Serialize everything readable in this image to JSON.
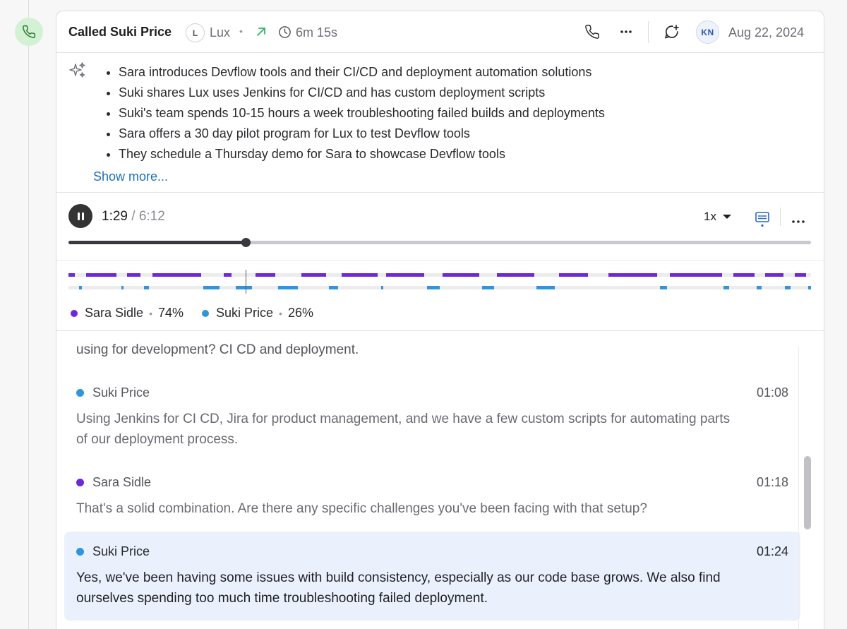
{
  "call": {
    "title": "Called Suki Price",
    "company_initial": "L",
    "company_name": "Lux",
    "separator": "•",
    "duration": "6m 15s",
    "user_initials": "KN",
    "date": "Aug 22, 2024"
  },
  "icons": {
    "call_type": "phone-icon",
    "direction": "outbound-arrow-icon",
    "duration": "clock-icon",
    "header_phone": "phone-icon",
    "header_more": "more-horizontal-icon",
    "comment": "add-comment-icon",
    "summary": "sparkle-icon",
    "captions": "captions-icon",
    "player_more": "more-horizontal-icon"
  },
  "summary": {
    "bullets": [
      "Sara introduces Devflow tools and their CI/CD and deployment automation solutions",
      "Suki shares Lux uses Jenkins for CI/CD and has custom deployment scripts",
      "Suki's team spends 10-15 hours a week troubleshooting failed builds and deployments",
      "Sara offers a 30 day pilot program for Lux to test Devflow tools",
      "They schedule a Thursday demo for Sara to showcase Devflow tools"
    ],
    "show_more_label": "Show more..."
  },
  "player": {
    "current_time": "1:29",
    "time_separator": " / ",
    "total_time": "6:12",
    "progress_fraction": 0.239,
    "speed_label": "1x"
  },
  "speakers": [
    {
      "name": "Sara Sidle",
      "percent": "74%",
      "color": "#6d28d9",
      "segments": [
        [
          0.0,
          0.009
        ],
        [
          0.024,
          0.065
        ],
        [
          0.079,
          0.097
        ],
        [
          0.113,
          0.179
        ],
        [
          0.209,
          0.22
        ],
        [
          0.252,
          0.279
        ],
        [
          0.314,
          0.347
        ],
        [
          0.368,
          0.416
        ],
        [
          0.428,
          0.479
        ],
        [
          0.504,
          0.553
        ],
        [
          0.577,
          0.627
        ],
        [
          0.661,
          0.7
        ],
        [
          0.727,
          0.793
        ],
        [
          0.81,
          0.88
        ],
        [
          0.895,
          0.924
        ],
        [
          0.938,
          0.963
        ],
        [
          0.978,
          0.993
        ]
      ]
    },
    {
      "name": "Suki Price",
      "percent": "26%",
      "color": "#2f95dc",
      "segments": [
        [
          0.014,
          0.018
        ],
        [
          0.071,
          0.074
        ],
        [
          0.102,
          0.108
        ],
        [
          0.182,
          0.203
        ],
        [
          0.225,
          0.247
        ],
        [
          0.282,
          0.309
        ],
        [
          0.351,
          0.363
        ],
        [
          0.421,
          0.424
        ],
        [
          0.483,
          0.5
        ],
        [
          0.557,
          0.573
        ],
        [
          0.63,
          0.635
        ],
        [
          0.634,
          0.639
        ],
        [
          0.63,
          0.655
        ],
        [
          0.797,
          0.806
        ],
        [
          0.882,
          0.89
        ],
        [
          0.927,
          0.933
        ],
        [
          0.965,
          0.972
        ],
        [
          0.996,
          1.0
        ]
      ]
    }
  ],
  "transcript": {
    "partial_text": "using for development? CI CD and deployment.",
    "entries": [
      {
        "speaker": "Suki Price",
        "time": "01:08",
        "text": "Using Jenkins for CI CD, Jira for product management, and we have a few custom scripts for automating parts of our deployment process.",
        "color": "#2f95dc"
      },
      {
        "speaker": "Sara Sidle",
        "time": "01:18",
        "text": "That's a solid combination. Are there any specific challenges you've been facing with that setup?",
        "color": "#6d28d9"
      },
      {
        "speaker": "Suki Price",
        "time": "01:24",
        "text": "Yes, we've been having some issues with build consistency, especially as our code base grows. We also find ourselves spending too much time troubleshooting failed deployment.",
        "color": "#2f95dc"
      }
    ]
  }
}
